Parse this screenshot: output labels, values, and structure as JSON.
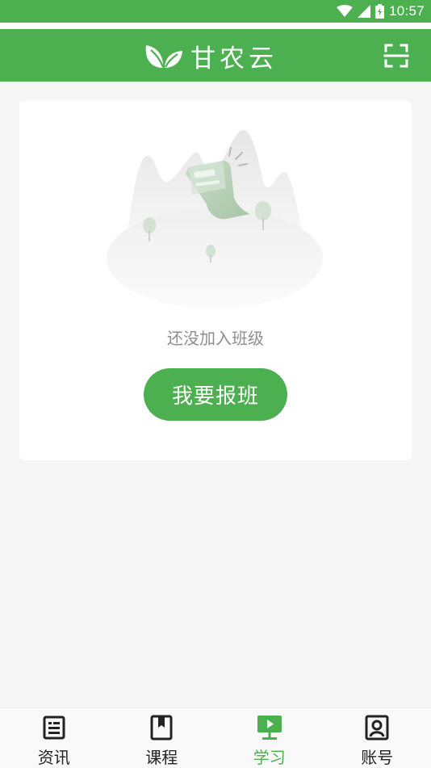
{
  "status_bar": {
    "time": "10:57",
    "icons": [
      "wifi-icon",
      "signal-icon",
      "battery-icon"
    ]
  },
  "header": {
    "title": "甘农云",
    "logo_icon": "leaf-logo-icon",
    "scan_icon": "scan-icon"
  },
  "empty_state": {
    "message": "还没加入班级",
    "button_label": "我要报班",
    "illustration": "empty-mountain-paper-illustration"
  },
  "bottom_nav": {
    "items": [
      {
        "label": "资讯",
        "icon": "news-icon",
        "active": false
      },
      {
        "label": "课程",
        "icon": "course-book-icon",
        "active": false
      },
      {
        "label": "学习",
        "icon": "study-screen-icon",
        "active": true
      },
      {
        "label": "账号",
        "icon": "account-icon",
        "active": false
      }
    ]
  },
  "colors": {
    "brand_green": "#4caf50",
    "background": "#f6f6f6",
    "muted_text": "#8e8e8e"
  }
}
